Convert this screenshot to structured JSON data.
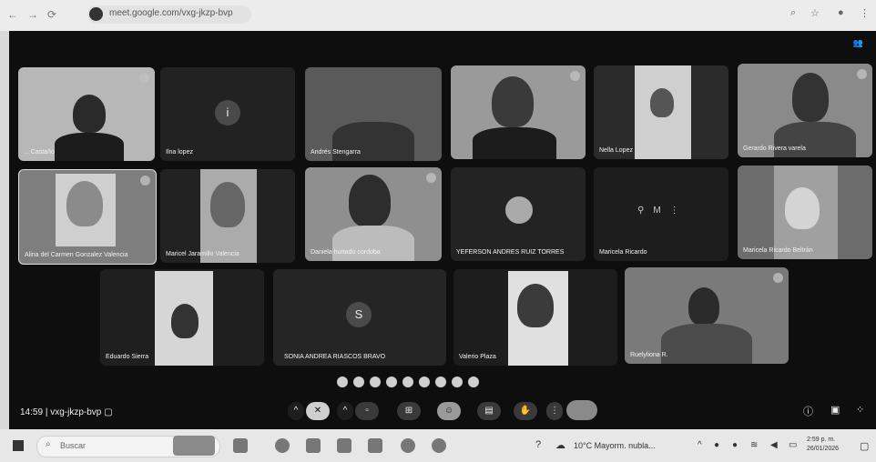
{
  "browser": {
    "url": "meet.google.com/vxg-jkzp-bvp"
  },
  "participants": [
    {
      "name": "... Castaño"
    },
    {
      "name": "Ilna lopez"
    },
    {
      "name": "Andrés Stengarra"
    },
    {
      "name": ""
    },
    {
      "name": "Nella Lopez"
    },
    {
      "name": "Gerardo Rivera varela"
    },
    {
      "name": "Alina del Carmen Gonzalez Valencia"
    },
    {
      "name": "Maricel Jaramillo Valencia"
    },
    {
      "name": "Daniela hurtado cordoba"
    },
    {
      "name": "YEFERSON ANDRES RUIZ TORRES"
    },
    {
      "name": "Maricela Ricardo"
    },
    {
      "name": "Maricela Ricardo Beltrán"
    },
    {
      "name": "Eduardo Sierra"
    },
    {
      "name": "SONIA ANDREA RIASCOS BRAVO",
      "initial": "S"
    },
    {
      "name": "Valerio Plaza"
    },
    {
      "name": "Ruelyliona R."
    }
  ],
  "meeting": {
    "time": "14:59",
    "separator": "|",
    "code": "vxg-jkzp-bvp"
  },
  "taskbar": {
    "search_placeholder": "Buscar",
    "weather": "10°C Mayorm. nubla...",
    "clock_time": "2:59 p. m.",
    "clock_date": "26/01/2026"
  }
}
